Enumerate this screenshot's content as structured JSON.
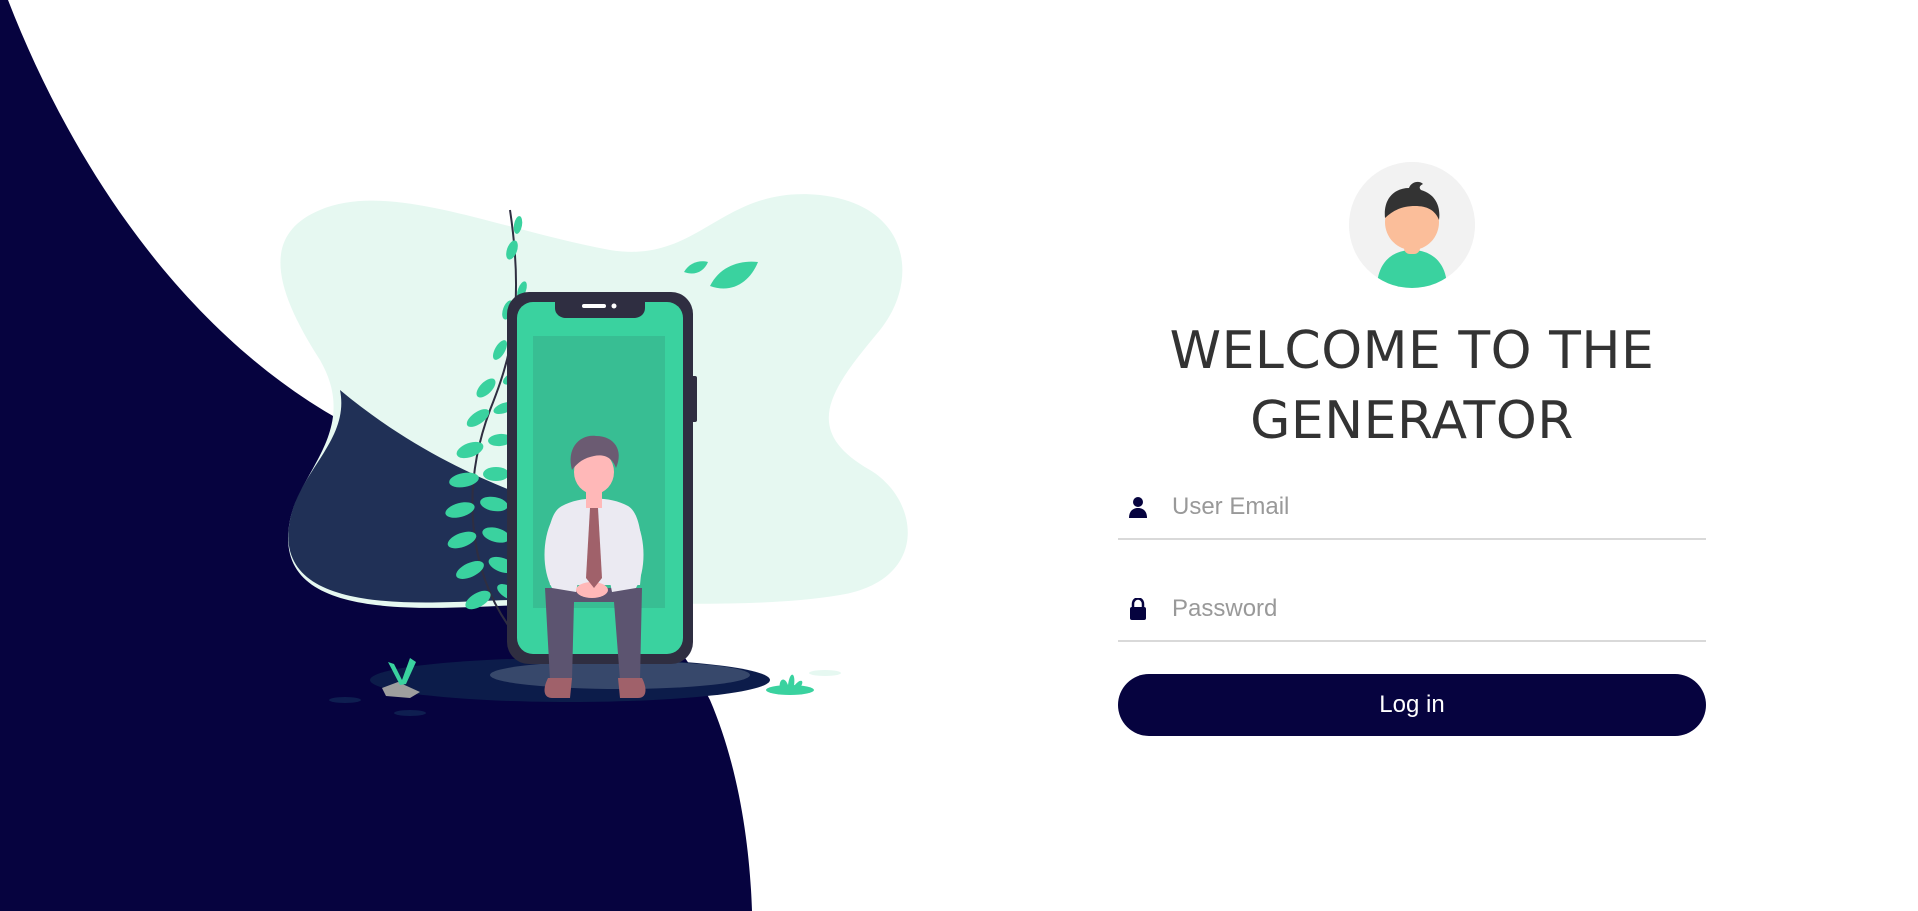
{
  "colors": {
    "navy": "#06033f",
    "mint": "#3ad29f",
    "blob": "#e6f8f1",
    "text": "#333333",
    "placeholder": "#999999",
    "underline": "#d9d9d9"
  },
  "login": {
    "title": "WELCOME TO THE GENERATOR",
    "email_placeholder": "User Email",
    "email_icon": "user-icon",
    "password_placeholder": "Password",
    "password_icon": "lock-icon",
    "button_label": "Log in"
  },
  "illustration": {
    "subject": "person-sitting-on-phone",
    "avatar": "user-avatar"
  }
}
